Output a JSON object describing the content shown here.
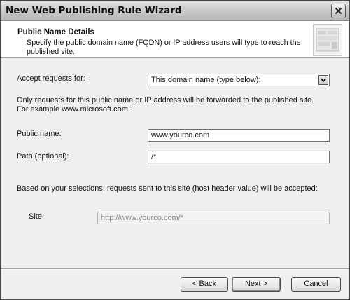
{
  "window": {
    "title": "New Web Publishing Rule Wizard"
  },
  "header": {
    "title": "Public Name Details",
    "description": "Specify the public domain name (FQDN) or IP address users will type to reach the published site."
  },
  "form": {
    "accept_label": "Accept requests for:",
    "accept_value": "This domain name (type below):",
    "info_text": "Only requests for this public name or IP address will be forwarded to the published site. For example www.microsoft.com.",
    "public_name_label": "Public name:",
    "public_name_value": "www.yourco.com",
    "path_label": "Path (optional):",
    "path_value": "/*",
    "selection_text": "Based on your selections, requests sent to this site (host header value) will be accepted:",
    "site_label": "Site:",
    "site_value": "http://www.yourco.com/*"
  },
  "buttons": {
    "back": "< Back",
    "next": "Next >",
    "cancel": "Cancel"
  },
  "icons": {
    "close": "close-icon",
    "dropdown": "chevron-down-icon",
    "wizard": "wizard-graphic-icon"
  }
}
